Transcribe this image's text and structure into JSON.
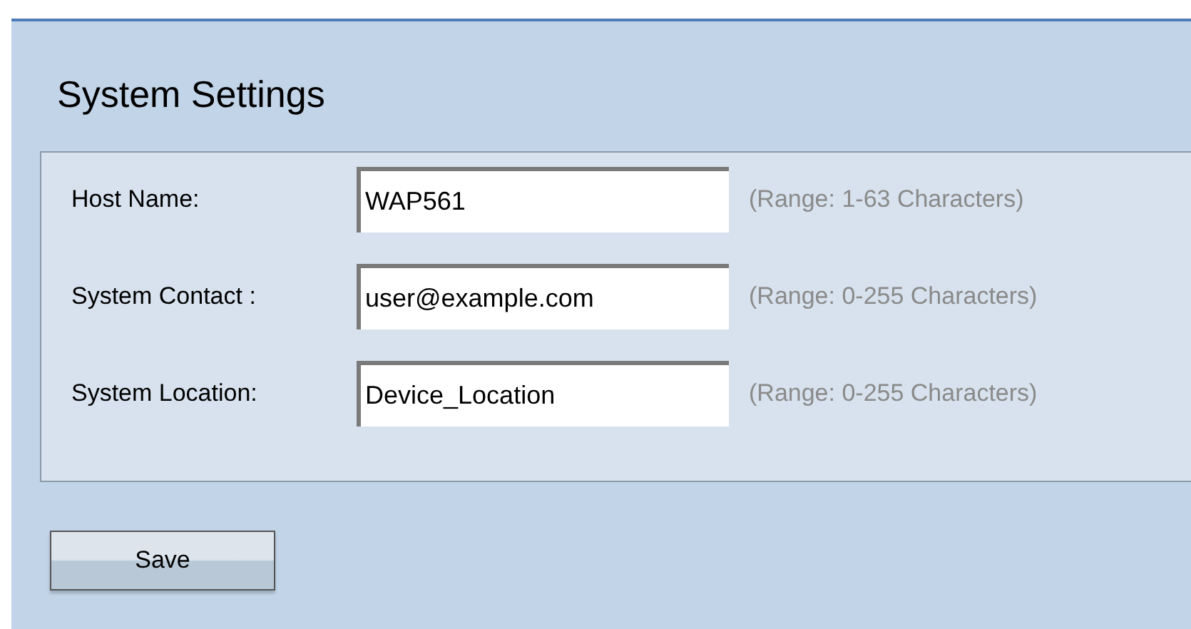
{
  "title": "System Settings",
  "fields": [
    {
      "label": "Host Name:",
      "value": "WAP561",
      "hint": "(Range: 1-63 Characters)"
    },
    {
      "label": "System Contact :",
      "value": "user@example.com",
      "hint": "(Range: 0-255 Characters)"
    },
    {
      "label": "System Location:",
      "value": "Device_Location",
      "hint": "(Range: 0-255 Characters)"
    }
  ],
  "buttons": [
    {
      "label": "Save"
    }
  ]
}
